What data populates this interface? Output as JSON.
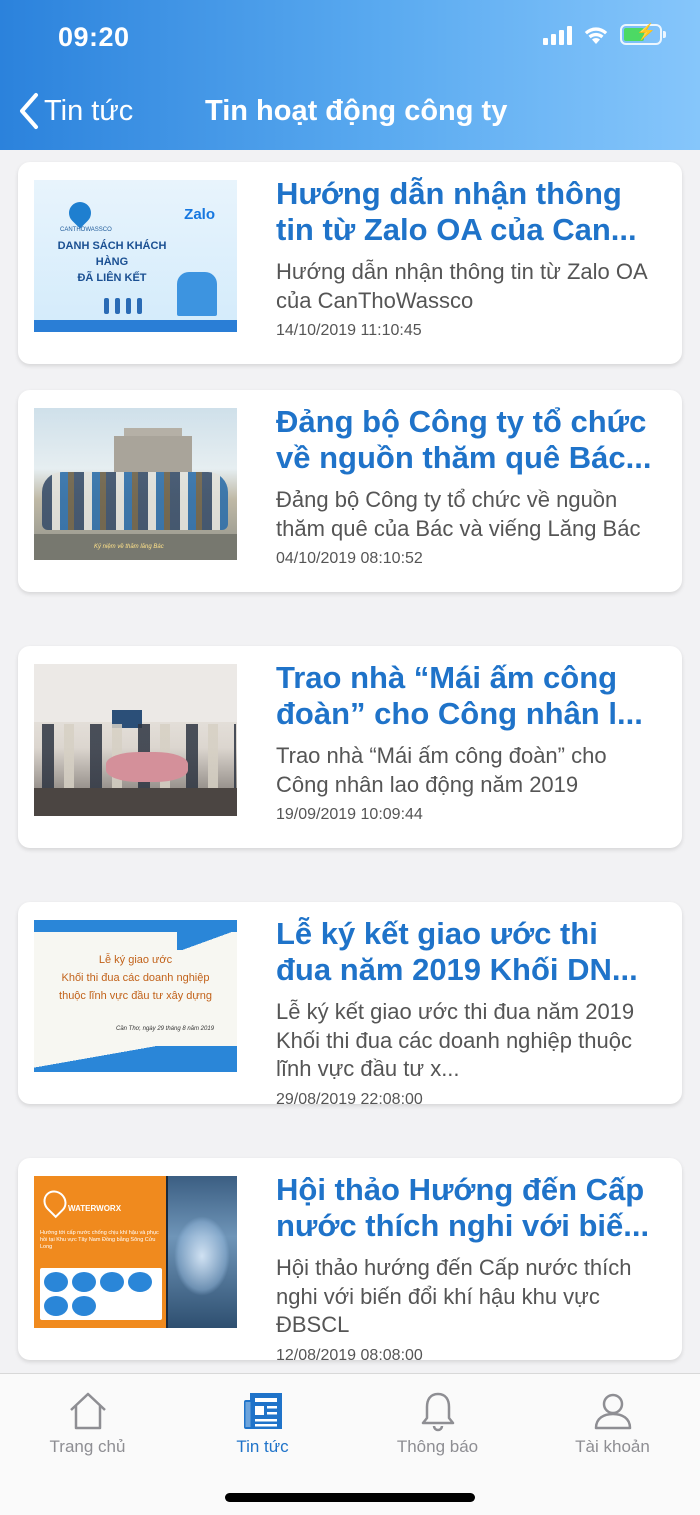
{
  "status_bar": {
    "time": "09:20",
    "icons": [
      "signal-icon",
      "wifi-icon",
      "battery-charging-icon"
    ]
  },
  "nav": {
    "back_label": "Tin tức",
    "title": "Tin hoạt động công ty"
  },
  "articles": [
    {
      "title": "Hướng dẫn nhận thông tin từ Zalo OA của Can...",
      "summary": "Hướng dẫn nhận thông tin từ Zalo OA của CanThoWassco",
      "date": "14/10/2019 11:10:45",
      "thumb": {
        "logo_text": "CANTHOWASSCO",
        "brand": "Zalo",
        "headline_1": "DANH SÁCH KHÁCH HÀNG",
        "headline_2": "ĐÃ LIÊN KẾT"
      }
    },
    {
      "title": "Đảng bộ Công ty tổ chức về nguồn thăm quê Bác...",
      "summary": "Đảng bộ Công ty tổ chức về nguồn thăm quê của Bác và viếng Lăng Bác",
      "date": "04/10/2019 08:10:52",
      "thumb": {
        "caption": "Kỷ niệm về thăm lăng Bác"
      }
    },
    {
      "title": "Trao nhà “Mái ấm công đoàn” cho Công nhân l...",
      "summary": "Trao nhà  “Mái ấm công đoàn” cho Công nhân lao động năm 2019",
      "date": "19/09/2019 10:09:44",
      "thumb": {}
    },
    {
      "title": "Lễ ký kết giao ước thi đua năm 2019 Khối DN...",
      "summary": "Lễ ký kết giao ước thi đua năm 2019 Khối thi đua các doanh nghiệp thuộc lĩnh vực đầu tư x...",
      "date": "29/08/2019 22:08:00",
      "thumb": {
        "line_1": "Lễ ký giao ước",
        "line_2": "Khối thi đua các doanh nghiệp",
        "line_3": "thuộc lĩnh vực đầu tư xây dựng",
        "date_line": "Cần Thơ, ngày 29 tháng 8 năm 2019"
      }
    },
    {
      "title": "Hội thảo Hướng đến Cấp nước thích nghi với biế...",
      "summary": "Hội thảo hướng đến Cấp nước thích nghi với biến đổi khí hậu khu vực ĐBSCL",
      "date": "12/08/2019 08:08:00",
      "thumb": {
        "brand": "WATERWORX",
        "text": "Hướng tới cấp nước chống chịu khí hậu và phục hồi tại Khu vực Tây Nam Đồng bằng Sông Cửu Long"
      }
    }
  ],
  "tabs": [
    {
      "label": "Trang chủ",
      "icon": "home-icon",
      "active": false
    },
    {
      "label": "Tin tức",
      "icon": "newspaper-icon",
      "active": true
    },
    {
      "label": "Thông báo",
      "icon": "bell-icon",
      "active": false
    },
    {
      "label": "Tài khoản",
      "icon": "user-icon",
      "active": false
    }
  ],
  "colors": {
    "header_start": "#2b82dc",
    "header_end": "#86c6fb",
    "accent": "#1f73c9",
    "inactive": "#8e8e93"
  }
}
